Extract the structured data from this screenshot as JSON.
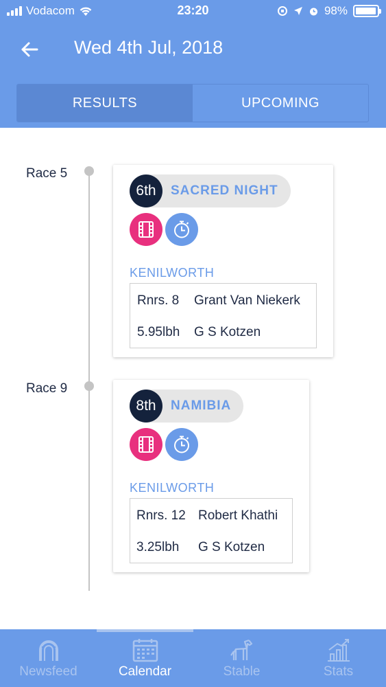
{
  "status_bar": {
    "carrier": "Vodacom",
    "time": "23:20",
    "battery": "98%",
    "battery_level": 0.98
  },
  "header": {
    "title": "Wed 4th Jul, 2018",
    "back_icon": "arrow-left-icon"
  },
  "tabs": [
    {
      "label": "RESULTS",
      "active": true
    },
    {
      "label": "UPCOMING",
      "active": false
    }
  ],
  "races": [
    {
      "label": "Race 5",
      "position": "6th",
      "horse": "SACRED NIGHT",
      "venue": "KENILWORTH",
      "runners": "Rnrs. 8",
      "jockey": "Grant Van Niekerk",
      "weight": "5.95lbh",
      "trainer": "G S Kotzen",
      "icons": [
        "film-icon",
        "stopwatch-icon"
      ]
    },
    {
      "label": "Race 9",
      "position": "8th",
      "horse": "NAMIBIA",
      "venue": "KENILWORTH",
      "runners": "Rnrs. 12",
      "jockey": "Robert Khathi",
      "weight": "3.25lbh",
      "trainer": "G S Kotzen",
      "icons": [
        "film-icon",
        "stopwatch-icon"
      ]
    }
  ],
  "bottom_nav": [
    {
      "label": "Newsfeed",
      "icon": "horseshoe-icon",
      "active": false
    },
    {
      "label": "Calendar",
      "icon": "calendar-icon",
      "active": true
    },
    {
      "label": "Stable",
      "icon": "horse-icon",
      "active": false
    },
    {
      "label": "Stats",
      "icon": "bar-chart-icon",
      "active": false
    }
  ],
  "colors": {
    "primary": "#6a9be8",
    "tab_active": "#5b88d3",
    "video": "#e8307e",
    "badge": "#14223c"
  }
}
